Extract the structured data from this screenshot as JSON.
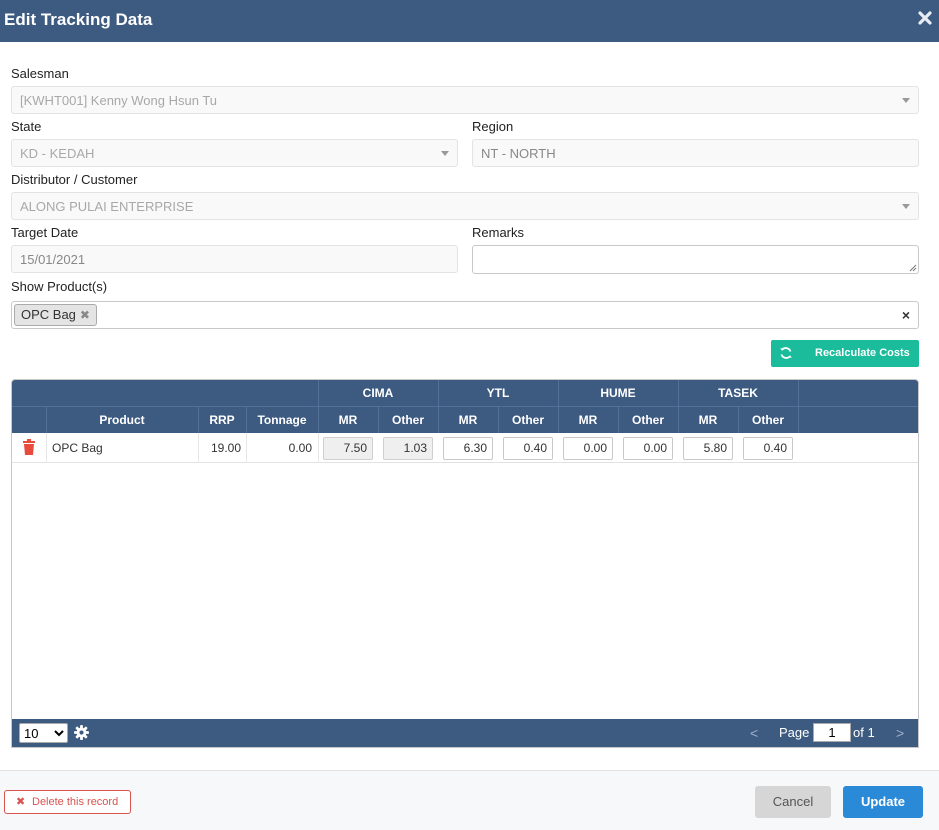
{
  "dialog": {
    "title": "Edit Tracking Data"
  },
  "form": {
    "salesman_label": "Salesman",
    "salesman_value": "[KWHT001] Kenny Wong Hsun Tu",
    "state_label": "State",
    "state_value": "KD - KEDAH",
    "region_label": "Region",
    "region_value": "NT - NORTH",
    "distributor_label": "Distributor / Customer",
    "distributor_value": "ALONG PULAI ENTERPRISE",
    "target_date_label": "Target Date",
    "target_date_value": "15/01/2021",
    "remarks_label": "Remarks",
    "remarks_value": "",
    "products_label": "Show Product(s)",
    "products_selected": [
      "OPC Bag"
    ],
    "products_clear": "×"
  },
  "actions": {
    "recalculate_label": "Recalculate Costs"
  },
  "grid": {
    "group_headers": [
      "CIMA",
      "YTL",
      "HUME",
      "TASEK"
    ],
    "columns": [
      "Product",
      "RRP",
      "Tonnage",
      "MR",
      "Other",
      "MR",
      "Other",
      "MR",
      "Other",
      "MR",
      "Other"
    ],
    "rows": [
      {
        "product": "OPC Bag",
        "rrp": "19.00",
        "tonnage": "0.00",
        "cima_mr": "7.50",
        "cima_other": "1.03",
        "ytl_mr": "6.30",
        "ytl_other": "0.40",
        "hume_mr": "0.00",
        "hume_other": "0.00",
        "tasek_mr": "5.80",
        "tasek_other": "0.40"
      }
    ]
  },
  "pager": {
    "page_size": "10",
    "page_size_options": [
      "10"
    ],
    "prev": "<",
    "page_label": "Page",
    "page_value": "1",
    "of_label": "of 1",
    "next": ">"
  },
  "footer": {
    "delete_label": "Delete this record",
    "cancel_label": "Cancel",
    "update_label": "Update"
  },
  "colors": {
    "header_bg": "#3d5a80",
    "accent_teal": "#1abc9c",
    "primary_blue": "#2b8ad8",
    "danger_red": "#d9534f"
  },
  "icons": [
    "close-icon",
    "dropdown-caret-icon",
    "refresh-icon",
    "trash-icon",
    "gear-icon",
    "resize-grip-icon"
  ]
}
